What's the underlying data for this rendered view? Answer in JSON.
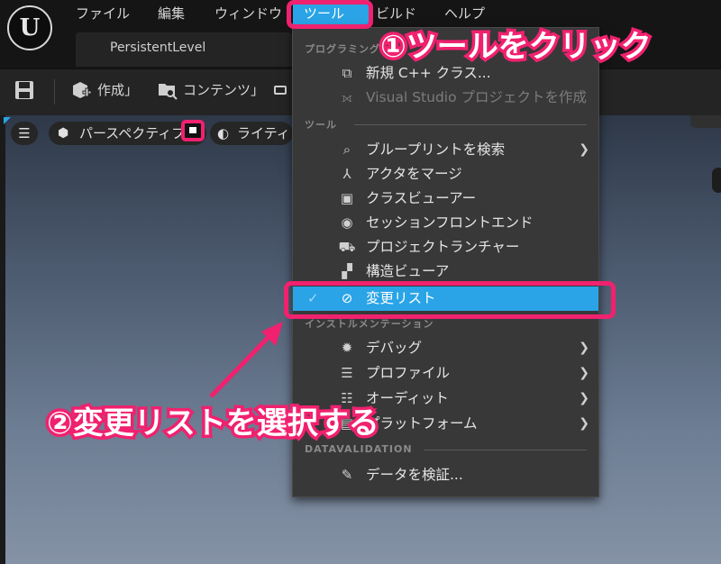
{
  "menubar": {
    "items": [
      "ファイル",
      "編集",
      "ウィンドウ",
      "ツール",
      "ビルド",
      "ヘルプ"
    ]
  },
  "level_tab": {
    "label": "PersistentLevel"
  },
  "toolbar": {
    "create_label": "作成",
    "content_label": "コンテンツ"
  },
  "viewport": {
    "perspective_label": "パースペクティブ",
    "lighting_label": "ライティ"
  },
  "tools_menu": {
    "programming_label": "プログラミング",
    "tools_label": "ツール",
    "instrumentation_label": "インストルメンテーション",
    "datavalidation_label": "DATAVALIDATION",
    "items": [
      {
        "label": "新規 C++ クラス...",
        "icon": "cpp-class-icon"
      },
      {
        "label": "Visual Studio プロジェクトを作成",
        "icon": "visual-studio-icon"
      },
      {
        "label": "ブループリントを検索",
        "icon": "find-blueprint-icon"
      },
      {
        "label": "アクタをマージ",
        "icon": "merge-actors-icon"
      },
      {
        "label": "クラスビューアー",
        "icon": "class-viewer-icon"
      },
      {
        "label": "セッションフロントエンド",
        "icon": "session-frontend-icon"
      },
      {
        "label": "プロジェクトランチャー",
        "icon": "project-launcher-icon"
      },
      {
        "label": "構造ビューア",
        "icon": "struct-viewer-icon"
      },
      {
        "label": "変更リスト",
        "icon": "changelist-icon"
      },
      {
        "label": "デバッグ",
        "icon": "debug-icon"
      },
      {
        "label": "プロファイル",
        "icon": "profile-icon"
      },
      {
        "label": "オーディット",
        "icon": "audit-icon"
      },
      {
        "label": "プラットフォーム",
        "icon": "platform-icon"
      },
      {
        "label": "データを検証...",
        "icon": "validate-data-icon"
      }
    ]
  },
  "annotations": {
    "step1": "①ツールをクリック",
    "step2": "②変更リストを選択する"
  },
  "colors": {
    "accent": "#2aa4e6",
    "annotation": "#f0216f"
  }
}
